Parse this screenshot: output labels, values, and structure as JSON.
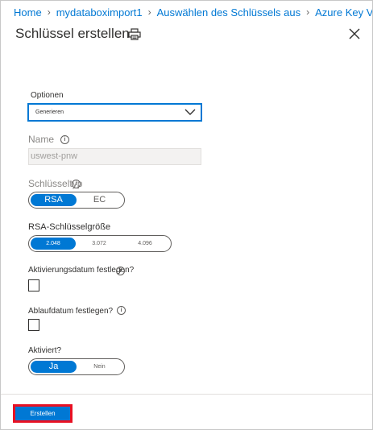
{
  "breadcrumb": [
    "Home",
    "mydataboximport1",
    "Auswählen des Schlüssels aus",
    "Azure Key Va"
  ],
  "header": {
    "title": "Schlüssel erstellen"
  },
  "options": {
    "label": "Optionen",
    "value": "Generieren"
  },
  "name": {
    "label": "Name",
    "value": "uswest-pnw"
  },
  "key_type": {
    "label": "Schlüsseltyp",
    "options": [
      "RSA",
      "EC"
    ],
    "selected": "RSA"
  },
  "key_size": {
    "label": "RSA-Schlüsselgröße",
    "options": [
      "2.048",
      "3.072",
      "4.096"
    ],
    "selected": "2.048"
  },
  "activation": {
    "label": "Aktivierungsdatum festlegen?",
    "checked": false
  },
  "expiry": {
    "label": "Ablaufdatum festlegen?",
    "checked": false
  },
  "enabled": {
    "label": "Aktiviert?",
    "options": [
      "Ja",
      "Nein"
    ],
    "selected": "Ja"
  },
  "footer": {
    "create_label": "Erstellen"
  },
  "colors": {
    "accent": "#0078d4",
    "highlight_border": "#e81123"
  }
}
